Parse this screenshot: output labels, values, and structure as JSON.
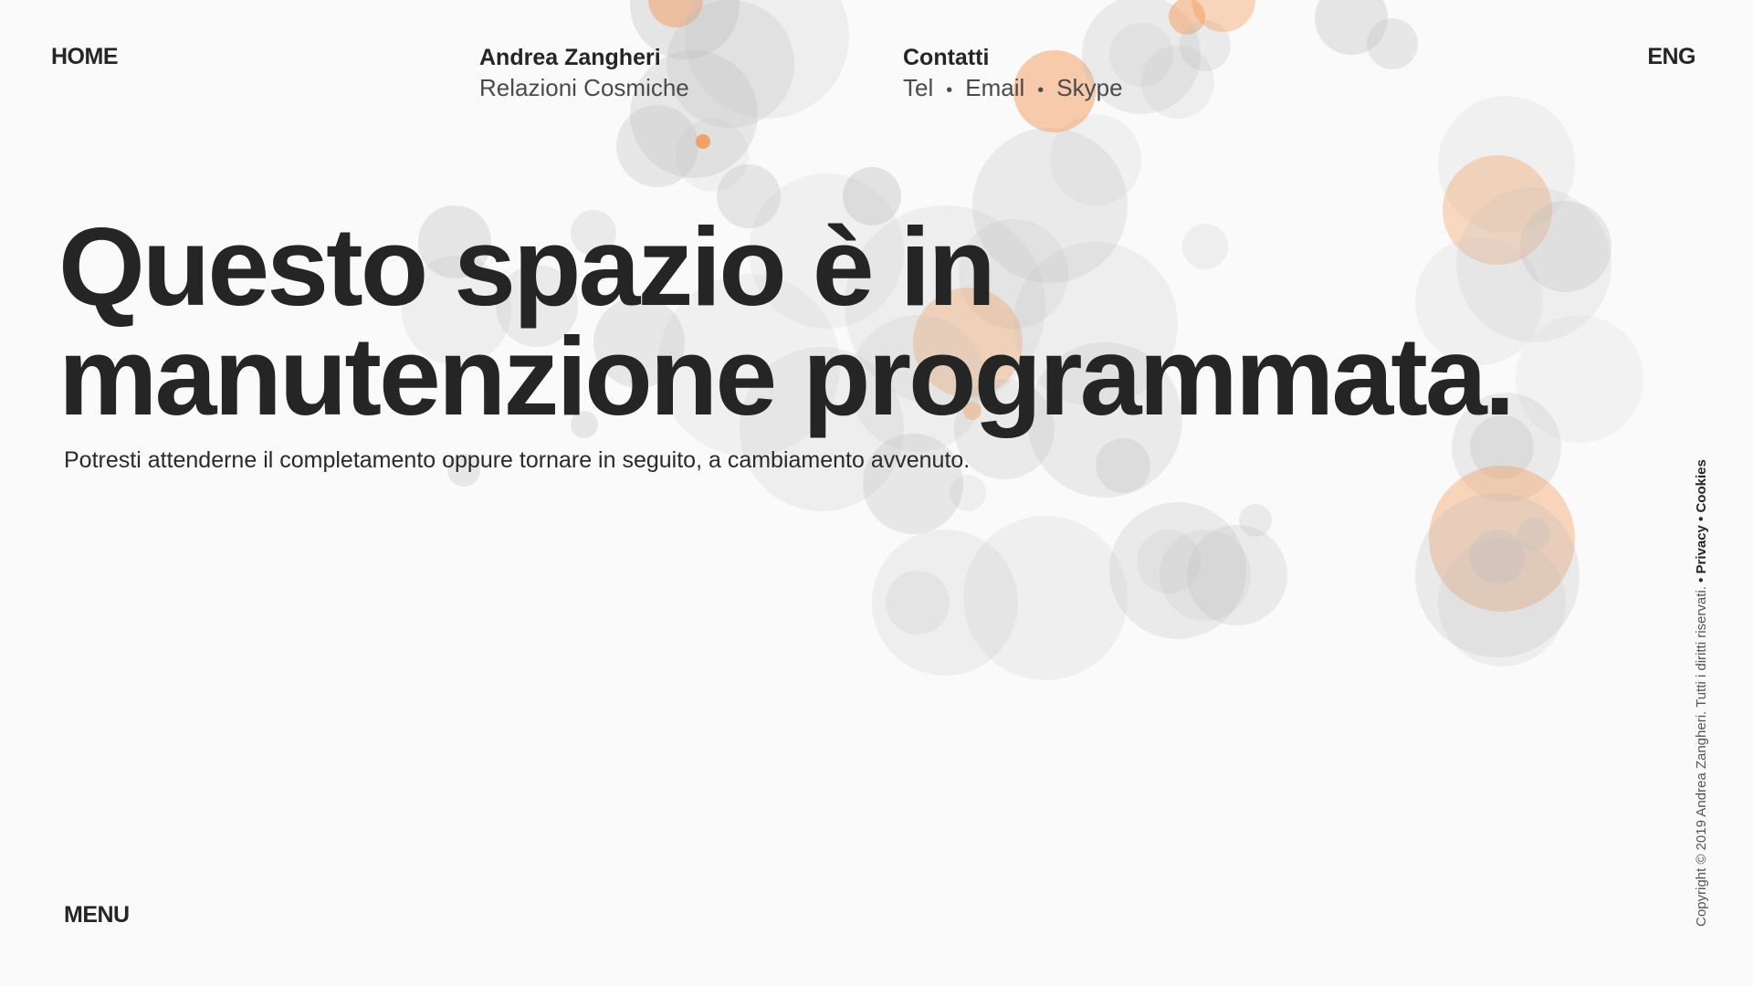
{
  "nav": {
    "home_label": "HOME",
    "brand_name": "Andrea Zangheri",
    "brand_tagline": "Relazioni Cosmiche",
    "contacts_title": "Contatti",
    "contact_tel": "Tel",
    "contact_email": "Email",
    "contact_skype": "Skype",
    "separator": "•",
    "lang_label": "ENG"
  },
  "hero": {
    "line1": "Questo spazio è in",
    "line2": "manutenzione programmata.",
    "subtitle": "Potresti attenderne il completamento oppure tornare in seguito, a cambiamento avvenuto."
  },
  "footer": {
    "menu_label": "MENU",
    "copyright": "Copyright © 2019 Andrea Zangheri. Tutti i diritti riservati.",
    "privacy_label": "• Privacy",
    "cookies_label": "• Cookies"
  },
  "colors": {
    "background": "#fafafa",
    "text": "#252525",
    "bubble_grey": "#bdbdbd",
    "bubble_orange": "#f29a5a"
  }
}
